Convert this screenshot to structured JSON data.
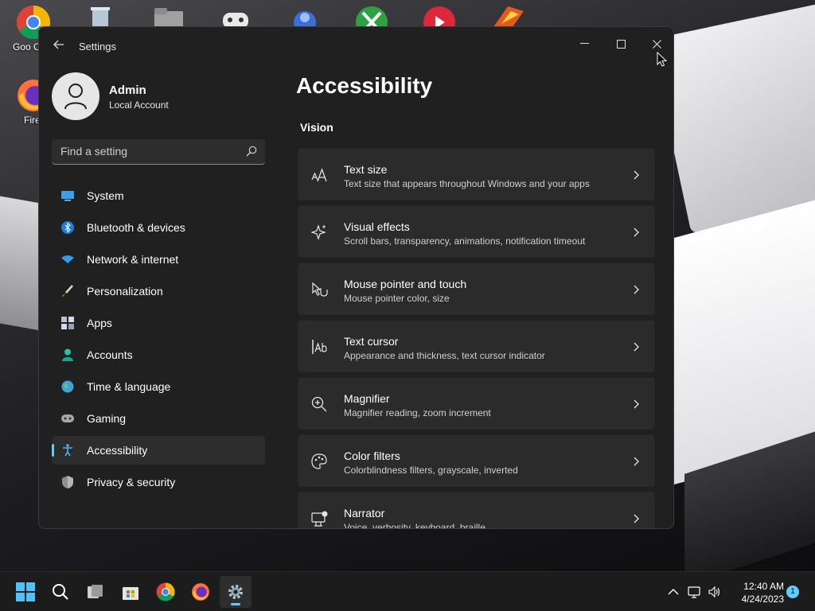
{
  "desktop": {
    "icons": [
      {
        "label": "Goo Chro",
        "name": "chrome-desktop-icon"
      },
      {
        "label": "Firef",
        "name": "firefox-desktop-icon"
      }
    ]
  },
  "window": {
    "title": "Settings"
  },
  "profile": {
    "name": "Admin",
    "account_type": "Local Account"
  },
  "search": {
    "placeholder": "Find a setting"
  },
  "nav": {
    "items": [
      {
        "label": "System",
        "icon": "system-icon"
      },
      {
        "label": "Bluetooth & devices",
        "icon": "bluetooth-icon"
      },
      {
        "label": "Network & internet",
        "icon": "wifi-icon"
      },
      {
        "label": "Personalization",
        "icon": "brush-icon"
      },
      {
        "label": "Apps",
        "icon": "apps-icon"
      },
      {
        "label": "Accounts",
        "icon": "person-icon"
      },
      {
        "label": "Time & language",
        "icon": "globe-icon"
      },
      {
        "label": "Gaming",
        "icon": "gamepad-icon"
      },
      {
        "label": "Accessibility",
        "icon": "accessibility-icon",
        "active": true
      },
      {
        "label": "Privacy & security",
        "icon": "shield-icon"
      }
    ]
  },
  "main": {
    "title": "Accessibility",
    "section": "Vision",
    "cards": [
      {
        "title": "Text size",
        "desc": "Text size that appears throughout Windows and your apps",
        "icon": "text-size-icon"
      },
      {
        "title": "Visual effects",
        "desc": "Scroll bars, transparency, animations, notification timeout",
        "icon": "sparkle-icon"
      },
      {
        "title": "Mouse pointer and touch",
        "desc": "Mouse pointer color, size",
        "icon": "pointer-touch-icon"
      },
      {
        "title": "Text cursor",
        "desc": "Appearance and thickness, text cursor indicator",
        "icon": "text-cursor-icon"
      },
      {
        "title": "Magnifier",
        "desc": "Magnifier reading, zoom increment",
        "icon": "magnifier-icon"
      },
      {
        "title": "Color filters",
        "desc": "Colorblindness filters, grayscale, inverted",
        "icon": "palette-icon"
      },
      {
        "title": "Narrator",
        "desc": "Voice, verbosity, keyboard, braille",
        "icon": "narrator-icon"
      }
    ]
  },
  "taskbar": {
    "time": "12:40 AM",
    "date": "4/24/2023",
    "notification_count": "1"
  },
  "colors": {
    "accent": "#60cdff",
    "window_bg": "#202020",
    "card_bg": "#2b2b2b"
  }
}
